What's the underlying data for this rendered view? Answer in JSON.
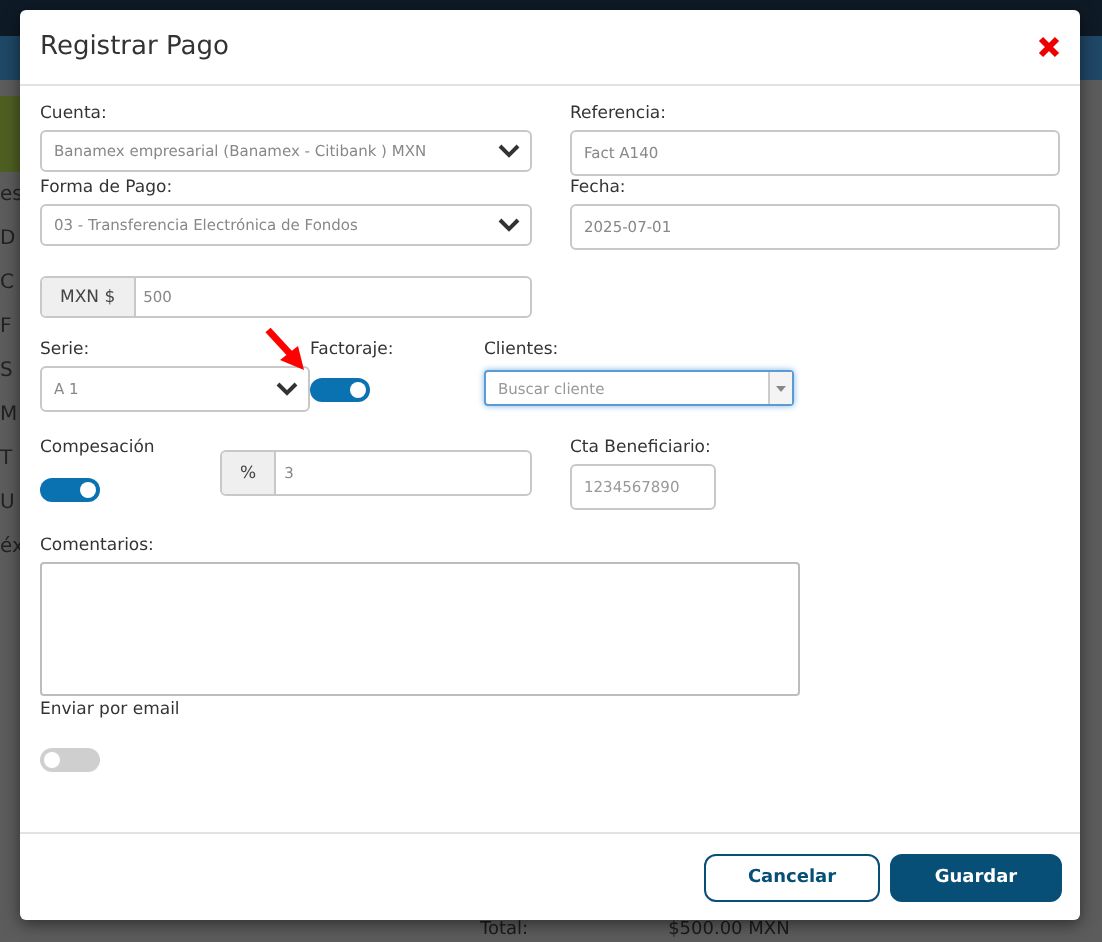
{
  "background": {
    "side_letters": [
      "es",
      "D",
      "C",
      "F",
      "S",
      "M",
      "T",
      "U",
      "éx"
    ],
    "total_label": "Total:",
    "total_value": "$500.00 MXN"
  },
  "modal": {
    "title": "Registrar Pago",
    "fields": {
      "cuenta": {
        "label": "Cuenta:",
        "value": "Banamex empresarial (Banamex - Citibank ) MXN"
      },
      "referencia": {
        "label": "Referencia:",
        "value": "Fact A140"
      },
      "forma_pago": {
        "label": "Forma de Pago:",
        "value": "03 - Transferencia Electrónica de Fondos"
      },
      "fecha": {
        "label": "Fecha:",
        "value": "2025-07-01"
      },
      "monto": {
        "addon": "MXN $",
        "value": "500"
      },
      "serie": {
        "label": "Serie:",
        "value": "A 1"
      },
      "factoraje": {
        "label": "Factoraje:",
        "on": true
      },
      "clientes": {
        "label": "Clientes:",
        "placeholder": "Buscar cliente"
      },
      "compesacion": {
        "label": "Compesación",
        "on": true
      },
      "porcentaje": {
        "addon": "%",
        "value": "3"
      },
      "cta_beneficiario": {
        "label": "Cta Beneficiario:",
        "placeholder": "1234567890"
      },
      "comentarios": {
        "label": "Comentarios:"
      },
      "enviar_email": {
        "label": "Enviar por email",
        "on": false
      }
    },
    "buttons": [
      {
        "label": "Cancelar",
        "kind": "secondary"
      },
      {
        "label": "Guardar",
        "kind": "primary"
      }
    ]
  }
}
